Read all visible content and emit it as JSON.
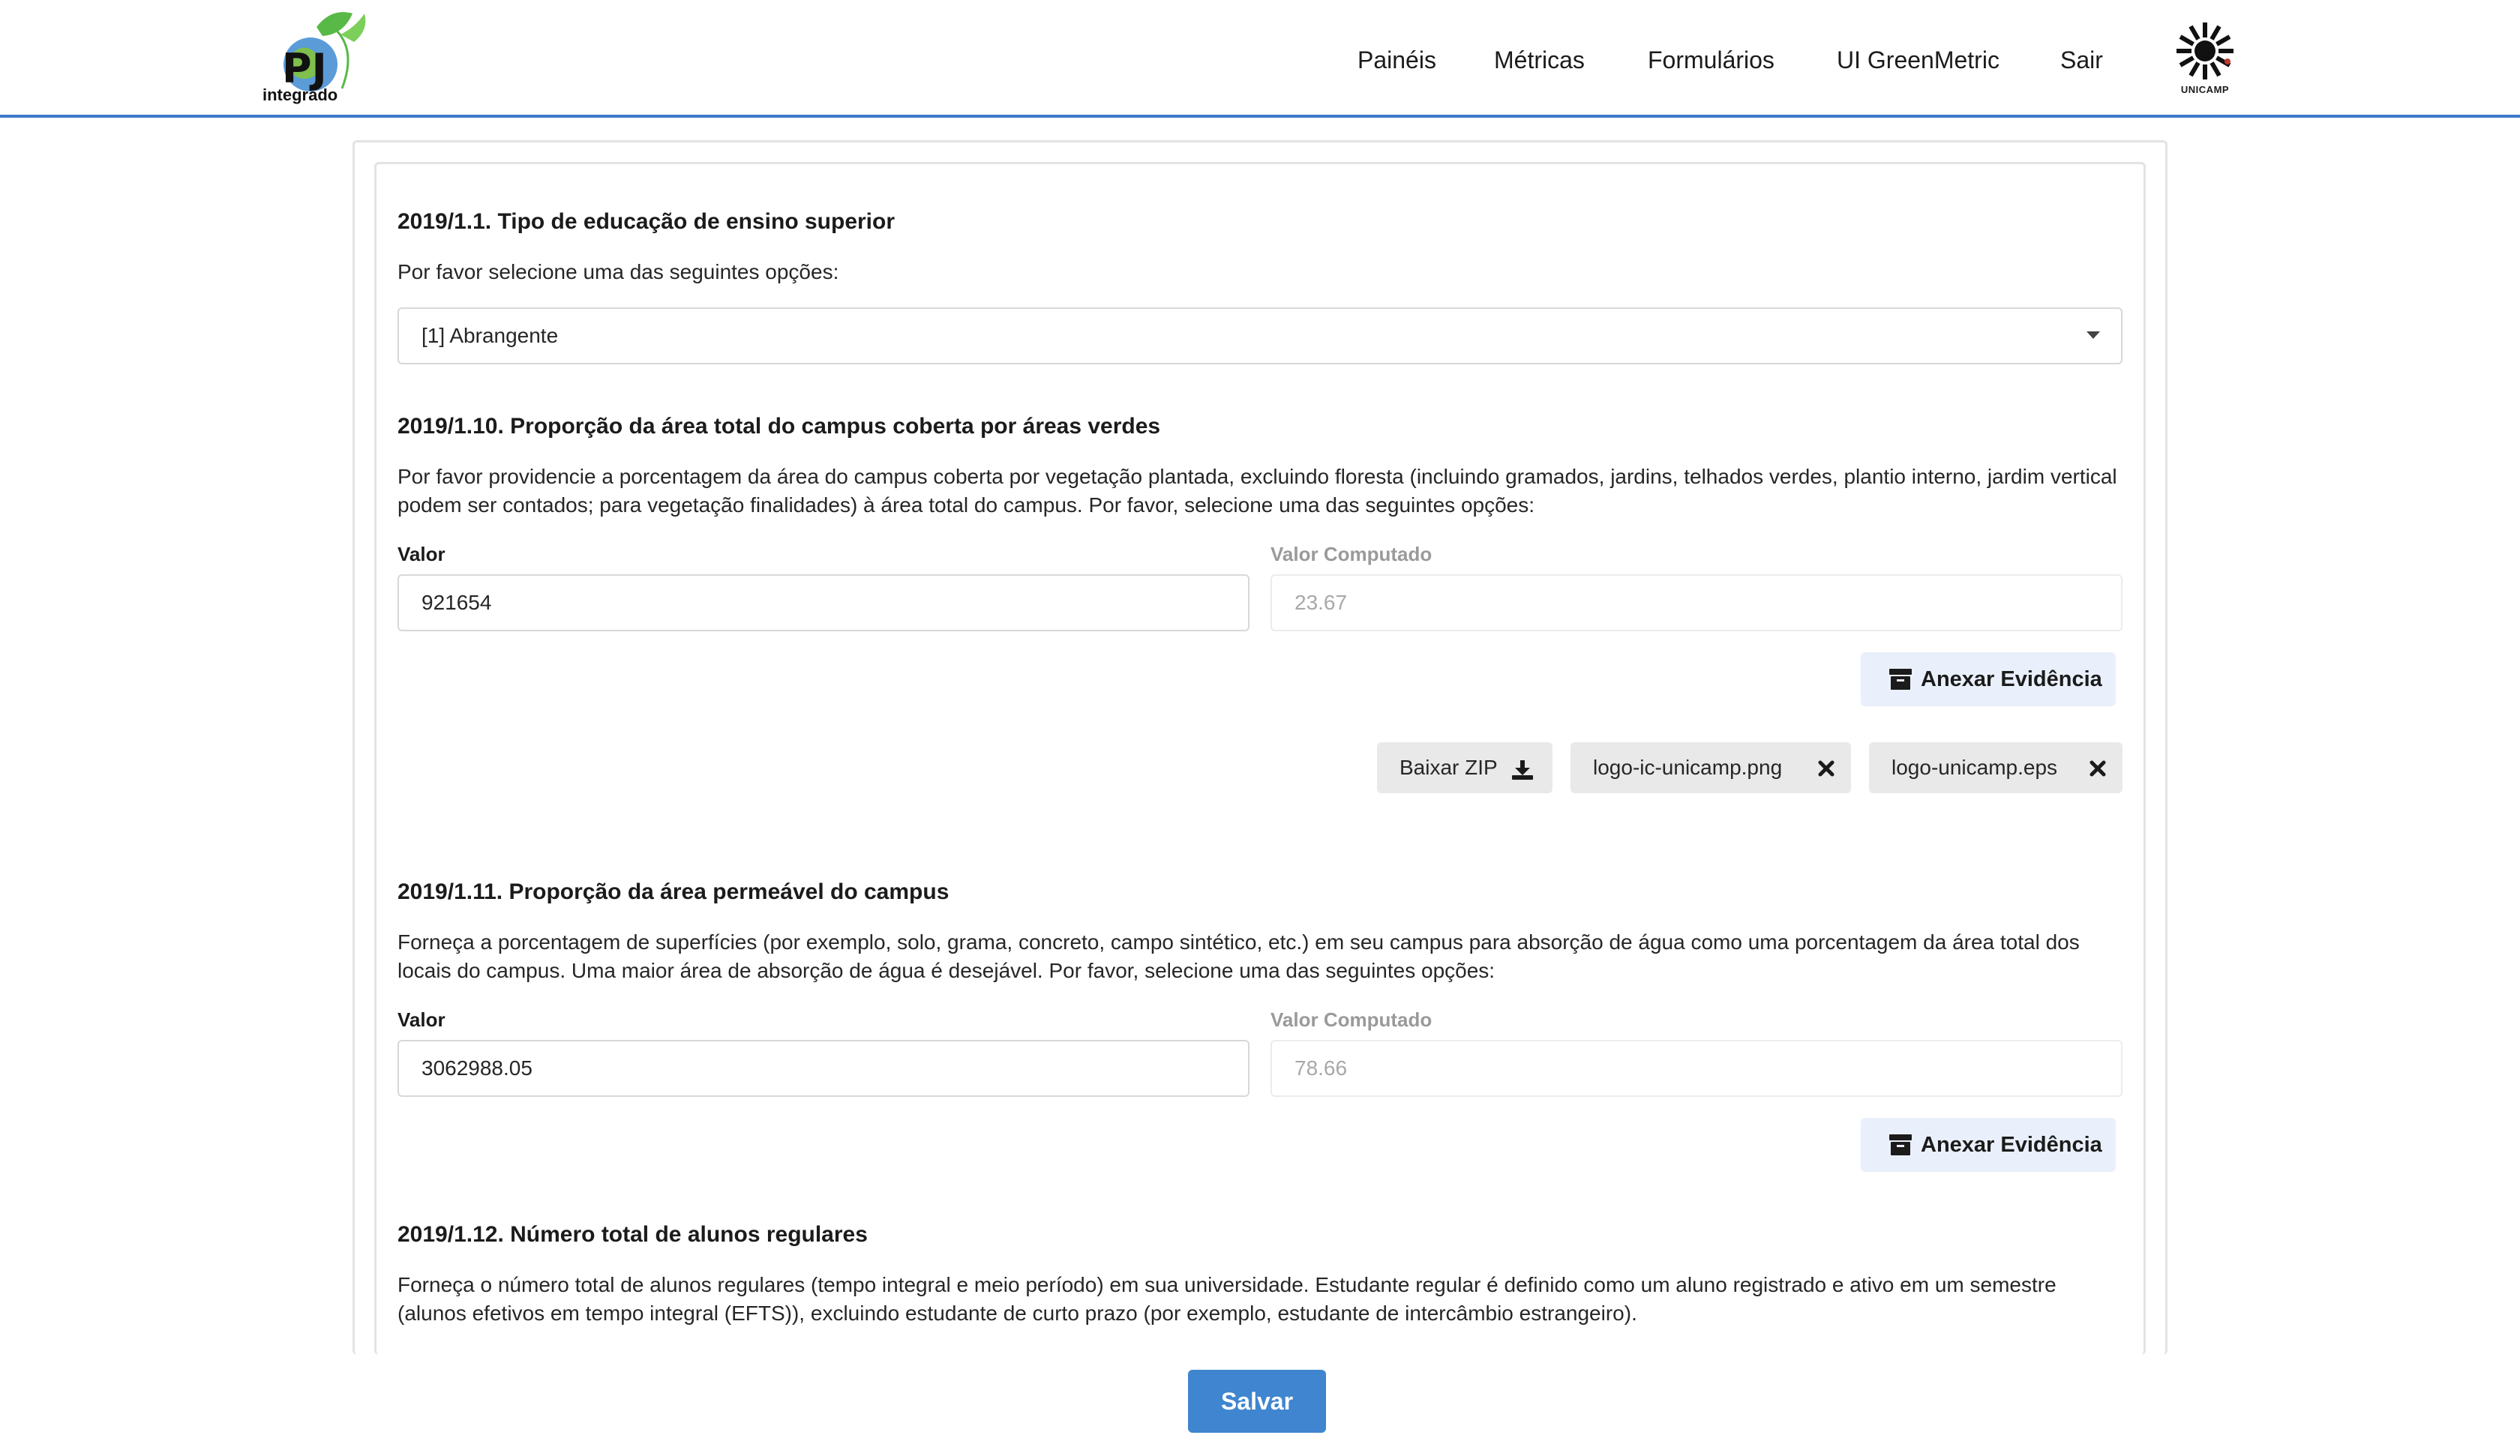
{
  "brand": {
    "logo_text": "integrado"
  },
  "nav": {
    "items": [
      {
        "label": "Painéis"
      },
      {
        "label": "Métricas"
      },
      {
        "label": "Formulários"
      },
      {
        "label": "UI GreenMetric"
      },
      {
        "label": "Sair"
      }
    ],
    "university_logo_text": "UNICAMP"
  },
  "questions": [
    {
      "title": "2019/1.1. Tipo de educação de ensino superior",
      "description": "Por favor selecione uma das seguintes opções:",
      "selected_option": "[1] Abrangente"
    },
    {
      "title": "2019/1.10. Proporção da área total do campus coberta por áreas verdes",
      "description": "Por favor providencie a porcentagem da área do campus coberta por vegetação plantada, excluindo floresta (incluindo gramados, jardins, telhados verdes, plantio interno, jardim vertical podem ser contados; para vegetação finalidades) à área total do campus. Por favor, selecione uma das seguintes opções:",
      "value_label": "Valor",
      "value": "921654",
      "computed_label": "Valor Computado",
      "computed_value": "23.67",
      "attach_label": "Anexar Evidência",
      "download_label": "Baixar ZIP",
      "files": [
        "logo-ic-unicamp.png",
        "logo-unicamp.eps"
      ]
    },
    {
      "title": "2019/1.11. Proporção da área permeável do campus",
      "description": "Forneça a porcentagem de superfícies (por exemplo, solo, grama, concreto, campo sintético, etc.) em seu campus para absorção de água como uma porcentagem da área total dos locais do campus. Uma maior área de absorção de água é desejável. Por favor, selecione uma das seguintes opções:",
      "value_label": "Valor",
      "value": "3062988.05",
      "computed_label": "Valor Computado",
      "computed_value": "78.66",
      "attach_label": "Anexar Evidência"
    },
    {
      "title": "2019/1.12. Número total de alunos regulares",
      "description": "Forneça o número total de alunos regulares (tempo integral e meio período) em sua universidade. Estudante regular é definido como um aluno registrado e ativo em um semestre (alunos efetivos em tempo integral (EFTS)), excluindo estudante de curto prazo (por exemplo, estudante de intercâmbio estrangeiro)."
    }
  ],
  "footer": {
    "save_label": "Salvar"
  },
  "colors": {
    "accent": "#3f85cf",
    "nav_border": "#3c7ac9",
    "evidence_bg": "#e9f0fb",
    "chip_bg": "#e9e9e9"
  },
  "icons": [
    "archive-icon",
    "download-icon",
    "close-icon",
    "chevron-down-icon",
    "sun-logo-icon"
  ]
}
